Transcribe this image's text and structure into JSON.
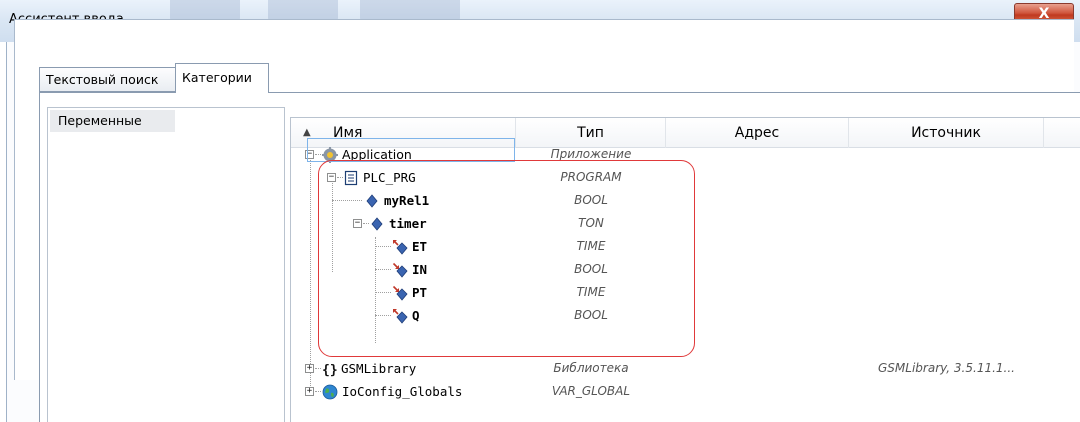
{
  "window": {
    "title": "Ассистент ввода",
    "close_glyph": "X"
  },
  "tabs": [
    {
      "label": "Текстовый поиск"
    },
    {
      "label": "Категории"
    }
  ],
  "categories": [
    {
      "label": "Переменные"
    }
  ],
  "columns": {
    "name": "Имя",
    "type": "Тип",
    "address": "Адрес",
    "source": "Источник",
    "sort_indicator": "▲"
  },
  "tree": {
    "application": {
      "name": "Application",
      "type": "Приложение",
      "expander": "−",
      "icon": "gear-icon"
    },
    "plc_prg": {
      "name": "PLC_PRG",
      "type": "PROGRAM",
      "expander": "−",
      "icon": "document-icon"
    },
    "myrel1": {
      "name": "myRel1",
      "type": "BOOL",
      "icon": "variable-icon"
    },
    "timer": {
      "name": "timer",
      "type": "TON",
      "expander": "−",
      "icon": "variable-icon"
    },
    "et": {
      "name": "ET",
      "type": "TIME",
      "icon": "output-variable-icon"
    },
    "in": {
      "name": "IN",
      "type": "BOOL",
      "icon": "input-variable-icon"
    },
    "pt": {
      "name": "PT",
      "type": "TIME",
      "icon": "input-variable-icon"
    },
    "q": {
      "name": "Q",
      "type": "BOOL",
      "icon": "output-variable-icon"
    },
    "gsmlibrary": {
      "name": "GSMLibrary",
      "type": "Библиотека",
      "source": "GSMLibrary, 3.5.11.1...",
      "expander": "+",
      "icon": "braces-icon"
    },
    "ioconfig": {
      "name": "IoConfig_Globals",
      "type": "VAR_GLOBAL",
      "expander": "+",
      "icon": "globe-icon"
    }
  },
  "colors": {
    "highlight_outline": "#e0393a",
    "selection_outline": "#7eb4ea"
  }
}
